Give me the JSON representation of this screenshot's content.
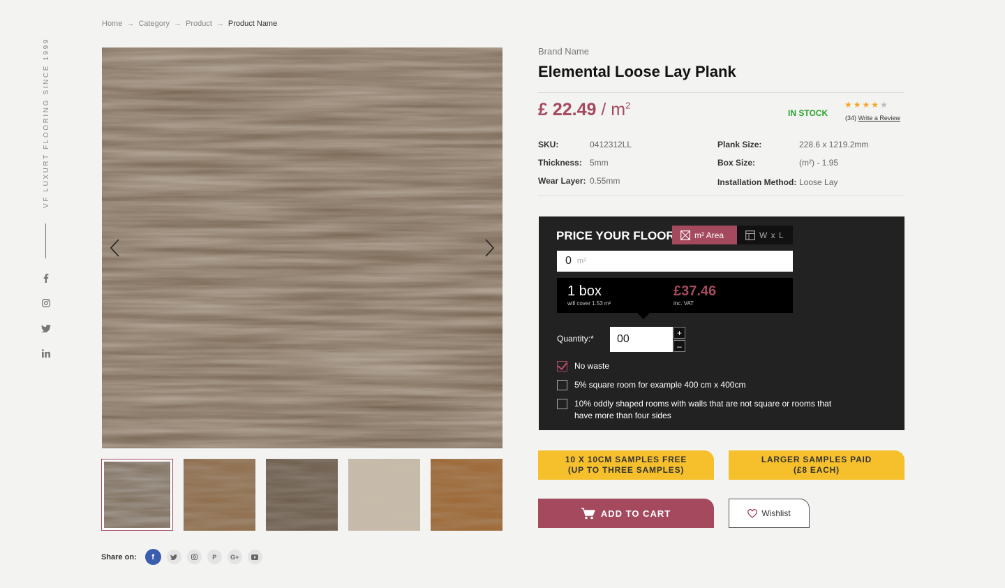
{
  "breadcrumb": {
    "items": [
      "Home",
      "Category",
      "Product",
      "Product Name"
    ],
    "separator": "→"
  },
  "rail": {
    "tagline": "VF LUXURT FLOORING SINCE 1999",
    "social_icons": [
      "facebook-icon",
      "instagram-icon",
      "twitter-icon",
      "linkedin-icon"
    ]
  },
  "gallery": {
    "main_image_alt": "wood-texture",
    "thumbnail_count": 5
  },
  "share": {
    "label": "Share on:",
    "icons": [
      "facebook-icon",
      "twitter-icon",
      "instagram-icon",
      "pinterest-icon",
      "google-plus-icon",
      "youtube-icon"
    ]
  },
  "product": {
    "brand": "Brand Name",
    "title": "Elemental Loose Lay Plank",
    "price": "£ 22.49",
    "price_unit": "/ m",
    "price_unit_sup": "2",
    "stock": "IN STOCK",
    "rating": 4,
    "rating_max": 5,
    "review_count": "(34)",
    "write_review": "Write a Review",
    "specs": {
      "sku_label": "SKU:",
      "sku": "0412312LL",
      "thickness_label": "Thickness:",
      "thickness": "5mm",
      "wear_label": "Wear Layer:",
      "wear": "0.55mm",
      "plank_label": "Plank Size:",
      "plank": "228.6 x 1219.2mm",
      "box_label": "Box Size:",
      "box": "(m²) - 1.95",
      "install_label": "Installation Method:",
      "install": "Loose Lay"
    }
  },
  "calculator": {
    "title": "PRICE YOUR FLOOR",
    "tab_area": "m² Area",
    "tab_wxl": "W x L",
    "area_value": "0",
    "area_unit": "m²",
    "boxes": "1 box",
    "covers": "will cover 1.53 m²",
    "total": "£37.46",
    "vat": "inc. VAT",
    "qty_label": "Quantity:*",
    "qty_value": "00",
    "qty_plus": "+",
    "qty_minus": "–",
    "options": [
      {
        "label": "No waste",
        "checked": true
      },
      {
        "label": "5% square room for example 400 cm x 400cm",
        "checked": false
      },
      {
        "label": "10% oddly shaped rooms with walls that are not square or rooms that have more than four sides",
        "checked": false
      }
    ]
  },
  "actions": {
    "samples_free_line1": "10 X 10CM SAMPLES FREE",
    "samples_free_line2": "(UP TO THREE SAMPLES)",
    "samples_paid_line1": "LARGER SAMPLES PAID",
    "samples_paid_line2": "(£8 EACH)",
    "add_to_cart": "ADD TO CART",
    "wishlist": "Wishlist"
  },
  "colors": {
    "accent": "#a54a5e",
    "stock": "#2aa32a",
    "sample_button": "#f5c02c",
    "calculator_bg": "#222222"
  }
}
